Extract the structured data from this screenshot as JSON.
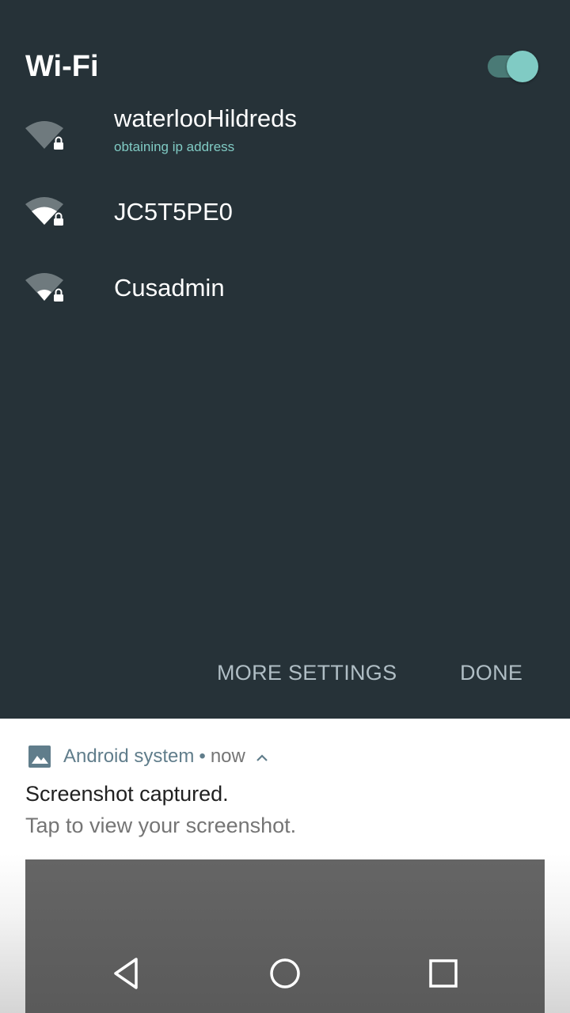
{
  "wifi": {
    "title": "Wi-Fi",
    "enabled": true,
    "networks": [
      {
        "name": "waterlooHildreds",
        "status": "obtaining ip address",
        "secured": true,
        "signal_icon": "wifi-signal-weak-icon"
      },
      {
        "name": "JC5T5PE0",
        "status": "",
        "secured": true,
        "signal_icon": "wifi-signal-medium-icon"
      },
      {
        "name": "Cusadmin",
        "status": "",
        "secured": true,
        "signal_icon": "wifi-signal-weak-icon"
      }
    ],
    "more_settings_label": "MORE SETTINGS",
    "done_label": "DONE"
  },
  "notification": {
    "app_icon": "image-icon",
    "app_name": "Android system",
    "separator": "•",
    "time": "now",
    "title": "Screenshot captured.",
    "text": "Tap to view your screenshot."
  },
  "navigation": {
    "back_icon": "back-triangle-icon",
    "home_icon": "home-circle-icon",
    "recents_icon": "recents-square-icon"
  },
  "colors": {
    "panel_bg": "#263238",
    "accent": "#80cbc4",
    "action_text": "#b0bec5",
    "notification_accent": "#607d8b"
  }
}
